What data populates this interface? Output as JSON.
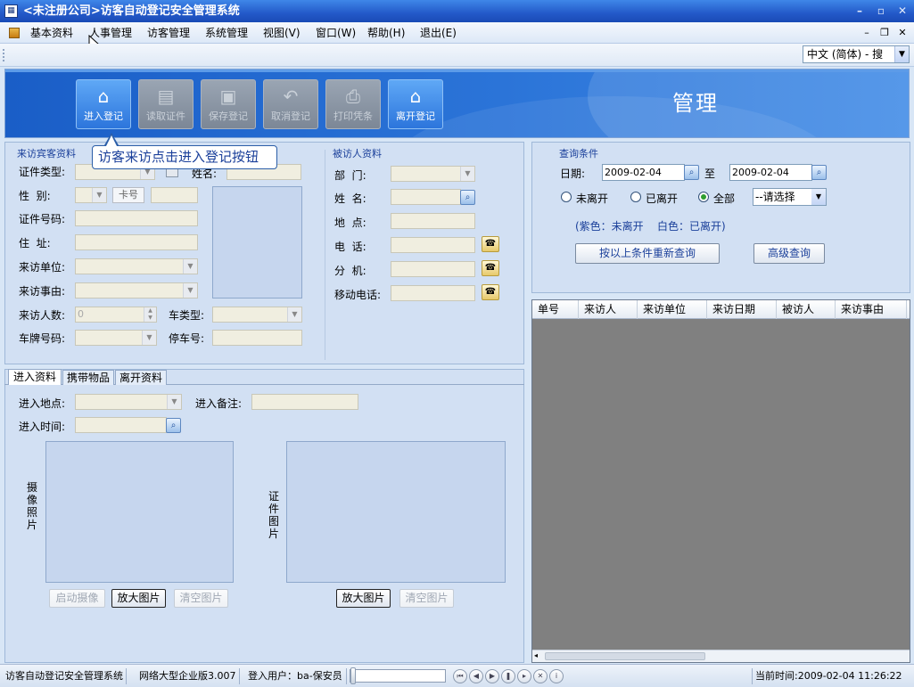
{
  "window": {
    "title": "<未注册公司>访客自动登记安全管理系统",
    "min": "–",
    "max": "▫",
    "close": "✕"
  },
  "menu": {
    "items": [
      "基本资料",
      "人事管理",
      "访客管理",
      "系统管理",
      "视图(V)",
      "窗口(W)",
      "帮助(H)",
      "退出(E)"
    ],
    "mdi_min": "–",
    "mdi_restore": "❐",
    "mdi_close": "✕"
  },
  "lang": {
    "value": "中文 (简体) - 搜"
  },
  "toolbar": {
    "enter": "进入登记",
    "read_id": "读取证件",
    "save": "保存登记",
    "cancel": "取消登记",
    "print": "打印凭条",
    "leave": "离开登记"
  },
  "banner_title": "管理",
  "tooltip": "访客来访点击进入登记按钮",
  "visitor": {
    "header": "来访宾客资料",
    "id_type": "证件类型:",
    "name": "姓名:",
    "gender": "性  别:",
    "card": "卡号",
    "id_no": "证件号码:",
    "address": "住  址:",
    "unit": "来访单位:",
    "reason": "来访事由:",
    "count": "来访人数:",
    "count_value": "0",
    "car_type": "车类型:",
    "plate": "车牌号码:",
    "parking": "停车号:"
  },
  "host": {
    "header": "被访人资料",
    "dept": "部  门:",
    "name": "姓  名:",
    "place": "地  点:",
    "phone": "电  话:",
    "ext": "分  机:",
    "mobile": "移动电话:"
  },
  "tabs": [
    "进入资料",
    "携带物品",
    "离开资料"
  ],
  "entry": {
    "place": "进入地点:",
    "remark": "进入备注:",
    "time": "进入时间:",
    "photo_caption": "摄像照片",
    "id_caption": "证件图片",
    "btn_camera": "启动摄像",
    "btn_zoom": "放大图片",
    "btn_clear": "清空图片"
  },
  "query": {
    "header": "查询条件",
    "date": "日期:",
    "date_from": "2009-02-04",
    "to": "至",
    "date_to": "2009-02-04",
    "r_not_left": "未离开",
    "r_left": "已离开",
    "r_all": "全部",
    "select": "--请选择",
    "legend": "(紫色：未离开    白色：已离开)",
    "btn_requery": "按以上条件重新查询",
    "btn_adv": "高级查询"
  },
  "grid": {
    "columns": [
      "单号",
      "来访人",
      "来访单位",
      "来访日期",
      "被访人",
      "来访事由"
    ]
  },
  "status": {
    "app": "访客自动登记安全管理系统",
    "edition": "网络大型企业版3.007",
    "user": "登入用户：ba-保安员",
    "time": "当前时间:2009-02-04 11:26:22"
  }
}
